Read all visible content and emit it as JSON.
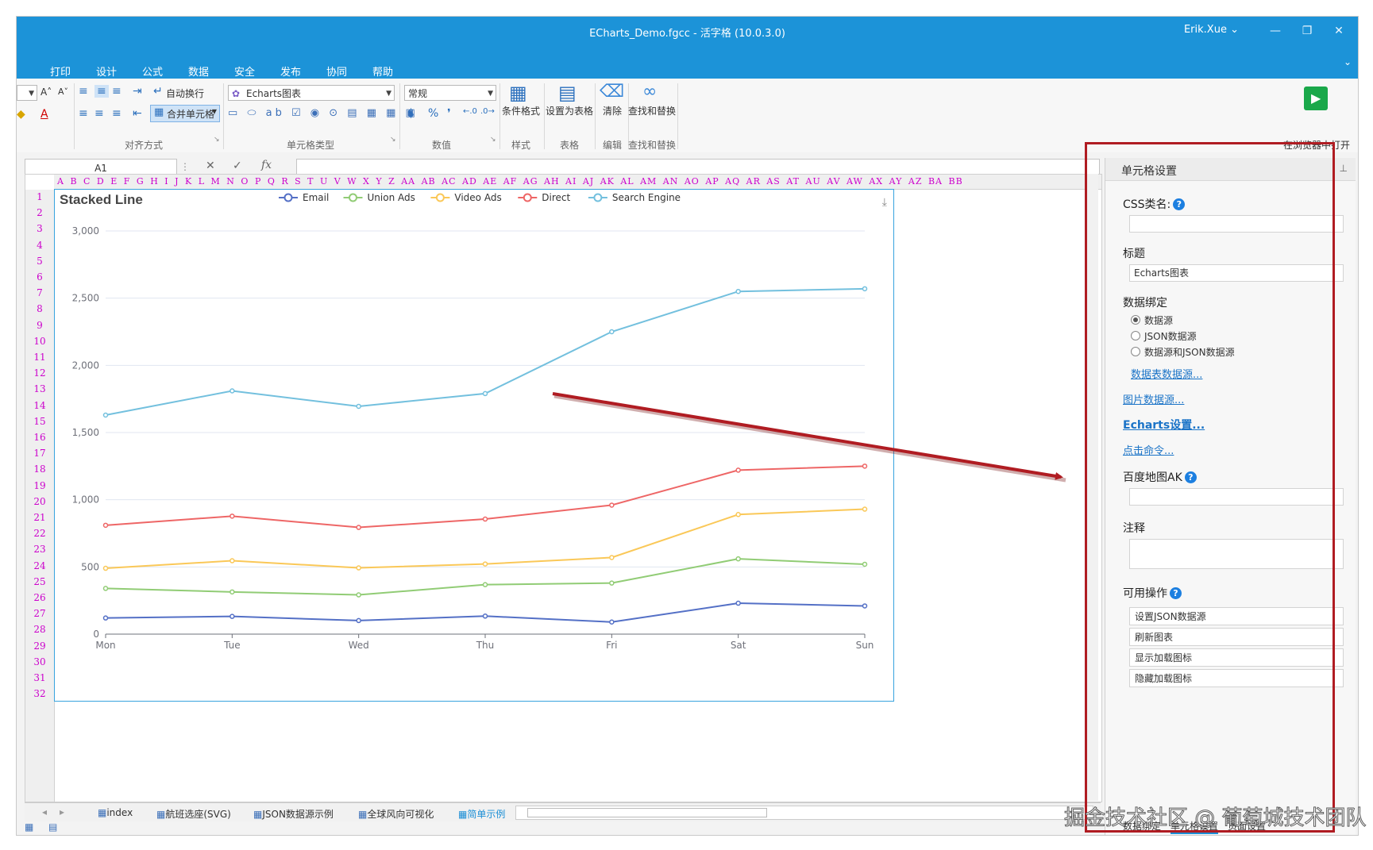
{
  "window": {
    "title": "ECharts_Demo.fgcc - 活字格 (10.0.3.0)",
    "user": "Erik.Xue",
    "minimize": "—",
    "restore": "❐",
    "close": "✕"
  },
  "menu": [
    "打印",
    "设计",
    "公式",
    "数据",
    "安全",
    "发布",
    "协同",
    "帮助"
  ],
  "ribbon": {
    "wrap_text": "自动换行",
    "merge_cells": "合并单元格",
    "align_group": "对齐方式",
    "cell_type_combo": "Echarts图表",
    "cell_type_group": "单元格类型",
    "number_format": "常规",
    "number_group": "数值",
    "conditional_format": "条件格式",
    "style_group": "样式",
    "set_as_table": "设置为表格",
    "table_group": "表格",
    "clear": "清除",
    "edit_group": "编辑",
    "find_replace": "查找和替换",
    "find_group": "查找和替换",
    "open_in_browser": "在浏览器中打开",
    "currency": "$",
    "percent": "%",
    "comma": "❜"
  },
  "formula_bar": {
    "name_box": "A1",
    "cancel": "✕",
    "confirm": "✓",
    "fx": "fx"
  },
  "columns": "A B C D E F G H I J K L M N O P Q R S T U V W X Y Z AA AB AC AD AE AF AG AH AI AJ AK AL AM AN AO AP AQ AR AS AT AU AV AW AX AY AZ BA BB",
  "rows": [
    "1",
    "2",
    "3",
    "4",
    "5",
    "6",
    "7",
    "8",
    "9",
    "10",
    "11",
    "12",
    "13",
    "14",
    "15",
    "16",
    "17",
    "18",
    "19",
    "20",
    "21",
    "22",
    "23",
    "24",
    "25",
    "26",
    "27",
    "28",
    "29",
    "30",
    "31",
    "32"
  ],
  "sheet_tabs": [
    "index",
    "航班选座(SVG)",
    "JSON数据源示例",
    "全球风向可视化",
    "简单示例"
  ],
  "active_tab": "简单示例",
  "panel": {
    "header": "单元格设置",
    "css_label": "CSS类名:",
    "title_label": "标题",
    "title_value": "Echarts图表",
    "binding_label": "数据绑定",
    "radios": [
      "数据源",
      "JSON数据源",
      "数据源和JSON数据源"
    ],
    "table_source_link": "数据表数据源...",
    "image_source_link": "图片数据源...",
    "echarts_settings_link": "Echarts设置...",
    "click_command_link": "点击命令...",
    "baidu_ak_label": "百度地图AK",
    "comment_label": "注释",
    "actions_label": "可用操作",
    "actions": [
      "设置JSON数据源",
      "刷新图表",
      "显示加载图标",
      "隐藏加载图标"
    ],
    "bottom_tabs": [
      "数据绑定",
      "单元格设置",
      "页面设置"
    ]
  },
  "watermark": "掘金技术社区 @ 葡萄城技术团队",
  "chart_data": {
    "type": "line",
    "title": "Stacked Line",
    "categories": [
      "Mon",
      "Tue",
      "Wed",
      "Thu",
      "Fri",
      "Sat",
      "Sun"
    ],
    "ylim": [
      0,
      3000
    ],
    "yticks": [
      0,
      500,
      1000,
      1500,
      2000,
      2500,
      3000
    ],
    "ytick_labels": [
      "0",
      "500",
      "1,000",
      "1,500",
      "2,000",
      "2,500",
      "3,000"
    ],
    "stacked": true,
    "grid": true,
    "legend_position": "top",
    "series": [
      {
        "name": "Email",
        "color": "#5470c6",
        "values": [
          120,
          132,
          101,
          134,
          90,
          230,
          210
        ]
      },
      {
        "name": "Union Ads",
        "color": "#91cc75",
        "values": [
          220,
          182,
          191,
          234,
          290,
          330,
          310
        ]
      },
      {
        "name": "Video Ads",
        "color": "#fac858",
        "values": [
          150,
          232,
          201,
          154,
          190,
          330,
          410
        ]
      },
      {
        "name": "Direct",
        "color": "#ee6666",
        "values": [
          320,
          332,
          301,
          334,
          390,
          330,
          320
        ]
      },
      {
        "name": "Search Engine",
        "color": "#73c0de",
        "values": [
          820,
          932,
          901,
          934,
          1290,
          1330,
          1320
        ]
      }
    ]
  }
}
